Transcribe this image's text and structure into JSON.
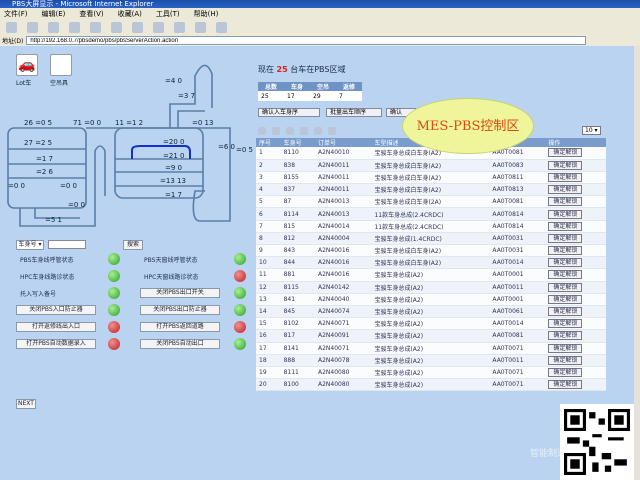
{
  "window": {
    "title": "PBS大屏显示 - Microsoft Internet Explorer"
  },
  "menu": [
    "文件(F)",
    "编辑(E)",
    "查看(V)",
    "收藏(A)",
    "工具(T)",
    "帮助(H)"
  ],
  "address": {
    "label": "地址(D)",
    "url": "http://192.168.0.7/pbsdemo/pbs/pbsServerAction.action"
  },
  "tiles": [
    {
      "label": "Lot车"
    },
    {
      "label": "空吊具"
    }
  ],
  "diagram_labels": [
    "26 =0 5",
    "71 =0 0",
    "11 =1 2",
    "=4 0",
    "=3 7",
    "=0 13",
    "27 =2 5",
    "=1 7",
    "=2 6",
    "=20 0",
    "=21 0",
    "=9 0",
    "=13 13",
    "=1 7",
    "=6 0",
    "=0 5",
    "=0 0",
    "=0 0",
    "=0 0",
    "=5 1"
  ],
  "search": {
    "select": "车身号",
    "button": "搜索"
  },
  "status_left": [
    {
      "label": "PBS车身线呼管状态",
      "lamp": "green",
      "type": "text"
    },
    {
      "label": "HPC车身线路诊状态",
      "lamp": "green",
      "type": "text"
    },
    {
      "label": "托入写入备号",
      "lamp": "green",
      "type": "text"
    },
    {
      "label": "关闭PBS入口防止器",
      "lamp": "green",
      "type": "button"
    },
    {
      "label": "打开返修线出入口",
      "lamp": "red",
      "type": "button"
    },
    {
      "label": "打开PBS自动数据录入",
      "lamp": "red",
      "type": "button"
    }
  ],
  "status_right": [
    {
      "label": "PBS天窗线呼管状态",
      "lamp": "green",
      "type": "text"
    },
    {
      "label": "HPC天窗线路诊状态",
      "lamp": "red",
      "type": "text"
    },
    {
      "label": "关闭PBS出口开关",
      "lamp": "green",
      "type": "button"
    },
    {
      "label": "关闭PBS出口防止器",
      "lamp": "green",
      "type": "button"
    },
    {
      "label": "打开PBS返回道路",
      "lamp": "red",
      "type": "button"
    },
    {
      "label": "关闭PBS自动出口",
      "lamp": "green",
      "type": "button"
    }
  ],
  "next_button": "NEXT",
  "summary": {
    "prefix": "现在",
    "count": "25",
    "suffix": "台车在PBS区域"
  },
  "mini_table": {
    "headers": [
      "总数",
      "车身",
      "空吊",
      "返修"
    ],
    "values": [
      "25",
      "17",
      "29",
      "7"
    ]
  },
  "top_buttons": [
    "确认入车身序",
    "批量出车顺序",
    "确认"
  ],
  "callout": "MES-PBS控制区",
  "pager": "10",
  "grid": {
    "headers": [
      "序号",
      "车身号",
      "订单号",
      "车型描述",
      "VIN",
      "操作"
    ],
    "rows": [
      [
        "1",
        "8110",
        "A2N40010",
        "宝骏车身总成白车身(A2)",
        "AA0T0081",
        "确定解锁"
      ],
      [
        "2",
        "838",
        "A2N40011",
        "宝骏车身总成白车身(A2)",
        "AA0T0083",
        "确定解锁"
      ],
      [
        "3",
        "8155",
        "A2N40011",
        "宝骏车身总成白车身(A2)",
        "AA0T0811",
        "确定解锁"
      ],
      [
        "4",
        "837",
        "A2N40011",
        "宝骏车身总成白车身(A2)",
        "AA0T0813",
        "确定解锁"
      ],
      [
        "5",
        "87",
        "A2N40013",
        "宝骏车身总成白车身(2A)",
        "AA0T0081",
        "确定解锁"
      ],
      [
        "6",
        "8114",
        "A2N40013",
        "11款车身总成(2.4CRDC)",
        "AA0T0814",
        "确定解锁"
      ],
      [
        "7",
        "815",
        "A2N40014",
        "11款车身总成(2.4CRDC)",
        "AA0T0814",
        "确定解锁"
      ],
      [
        "8",
        "812",
        "A2N40004",
        "宝骏车身总成(1.4CRDC)",
        "AA0T0031",
        "确定解锁"
      ],
      [
        "9",
        "843",
        "A2N40016",
        "宝骏车身总成白车身(A2)",
        "AA0T0031",
        "确定解锁"
      ],
      [
        "10",
        "844",
        "A2N40016",
        "宝骏车身总成白车身(A2)",
        "AA0T0014",
        "确定解锁"
      ],
      [
        "11",
        "881",
        "A2N40016",
        "宝骏车身总成(A2)",
        "AA0T0001",
        "确定解锁"
      ],
      [
        "12",
        "8115",
        "A2N40142",
        "宝骏车身总成(A2)",
        "AA0T0011",
        "确定解锁"
      ],
      [
        "13",
        "841",
        "A2N40040",
        "宝骏车身总成(A2)",
        "AA0T0001",
        "确定解锁"
      ],
      [
        "14",
        "845",
        "A2N40074",
        "宝骏车身总成(A2)",
        "AA0T0061",
        "确定解锁"
      ],
      [
        "15",
        "8102",
        "A2N40071",
        "宝骏车身总成(A2)",
        "AA0T0014",
        "确定解锁"
      ],
      [
        "16",
        "817",
        "A2N40091",
        "宝骏车身总成(A2)",
        "AA0T0081",
        "确定解锁"
      ],
      [
        "17",
        "8141",
        "A2N40071",
        "宝骏车身总成(A2)",
        "AA0T0071",
        "确定解锁"
      ],
      [
        "18",
        "888",
        "A2N40078",
        "宝骏车身总成(A2)",
        "AA0T0011",
        "确定解锁"
      ],
      [
        "19",
        "8111",
        "A2N40080",
        "宝骏车身总成(A2)",
        "AA0T0071",
        "确定解锁"
      ],
      [
        "20",
        "8100",
        "A2N40080",
        "宝骏车身总成(A2)",
        "AA0T0071",
        "确定解锁"
      ]
    ]
  },
  "watermark": "智能制造"
}
